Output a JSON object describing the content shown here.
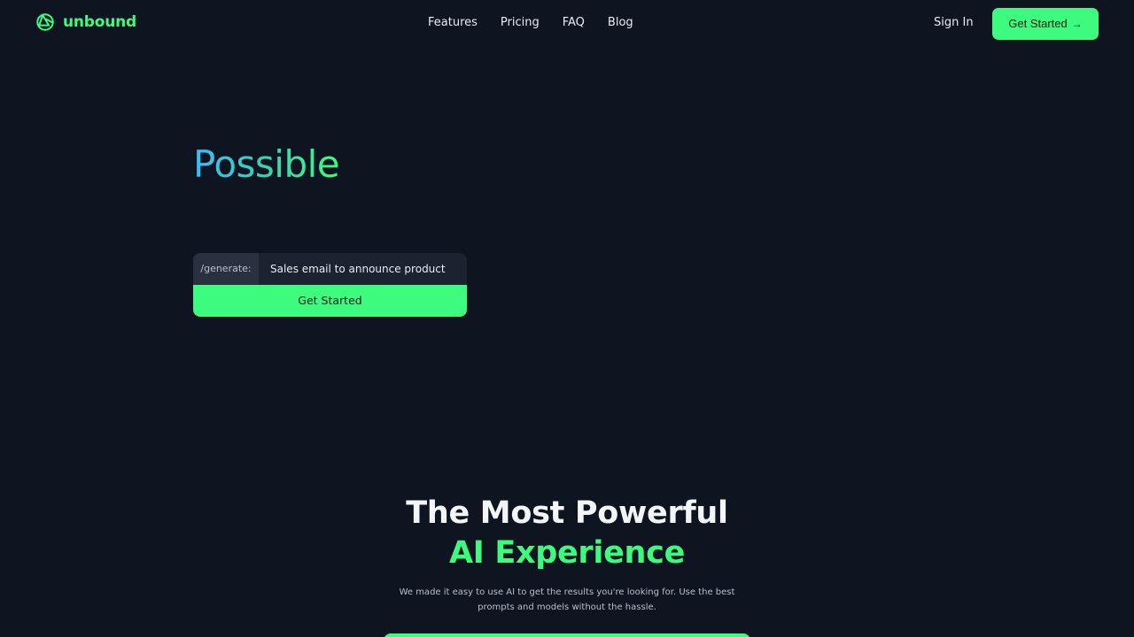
{
  "brand": {
    "name": "unbound",
    "icon": "unbound-logo-icon",
    "color": "#3cfb7f"
  },
  "nav": {
    "items": [
      {
        "label": "Features"
      },
      {
        "label": "Pricing"
      },
      {
        "label": "FAQ"
      },
      {
        "label": "Blog"
      }
    ]
  },
  "header": {
    "sign_in_label": "Sign In",
    "cta_label": "Get Started",
    "cta_icon": "arrow-right-icon"
  },
  "hero": {
    "headline_word": "Possible",
    "gradient": [
      "#38bdf8",
      "#3cfb7f"
    ],
    "prompt": {
      "prefix": "/generate:",
      "value": "Sales email to announce product",
      "button_label": "Get Started"
    }
  },
  "section": {
    "title_line1": "The Most Powerful",
    "title_line2": "AI Experience",
    "description": "We made it easy to use AI to get the results you're looking for. Use the best prompts and models without the hassle."
  },
  "colors": {
    "background": "#0e1420",
    "accent": "#3cfb7f",
    "input_bg": "#1c2230",
    "prefix_bg": "#2a303f"
  }
}
